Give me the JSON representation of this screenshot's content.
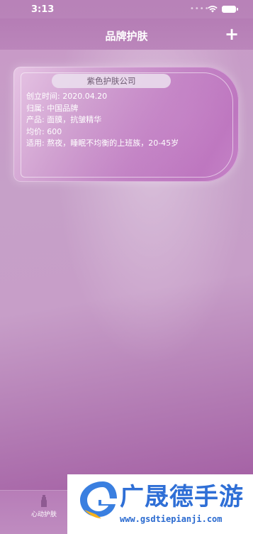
{
  "status_bar": {
    "time": "3:13",
    "dots": "••••"
  },
  "nav": {
    "title": "品牌护肤",
    "add_label": "+"
  },
  "card": {
    "title": "紫色护肤公司",
    "lines": [
      "创立时间: 2020.04.20",
      "归属: 中国品牌",
      "产品: 面膜，抗皱精华",
      "均价: 600",
      "适用: 熬夜，睡眠不均衡的上班族，20-45岁"
    ]
  },
  "tab_bar": {
    "items": [
      {
        "label": "心动护肤",
        "icon": "bottle-icon"
      }
    ]
  },
  "watermark": {
    "title": "广晟德手游",
    "url": "www.gsdtiepianji.com"
  },
  "colors": {
    "background": "#c394c2",
    "card_pill": "#ebe1ee",
    "watermark_blue": "#2f6fd6"
  }
}
